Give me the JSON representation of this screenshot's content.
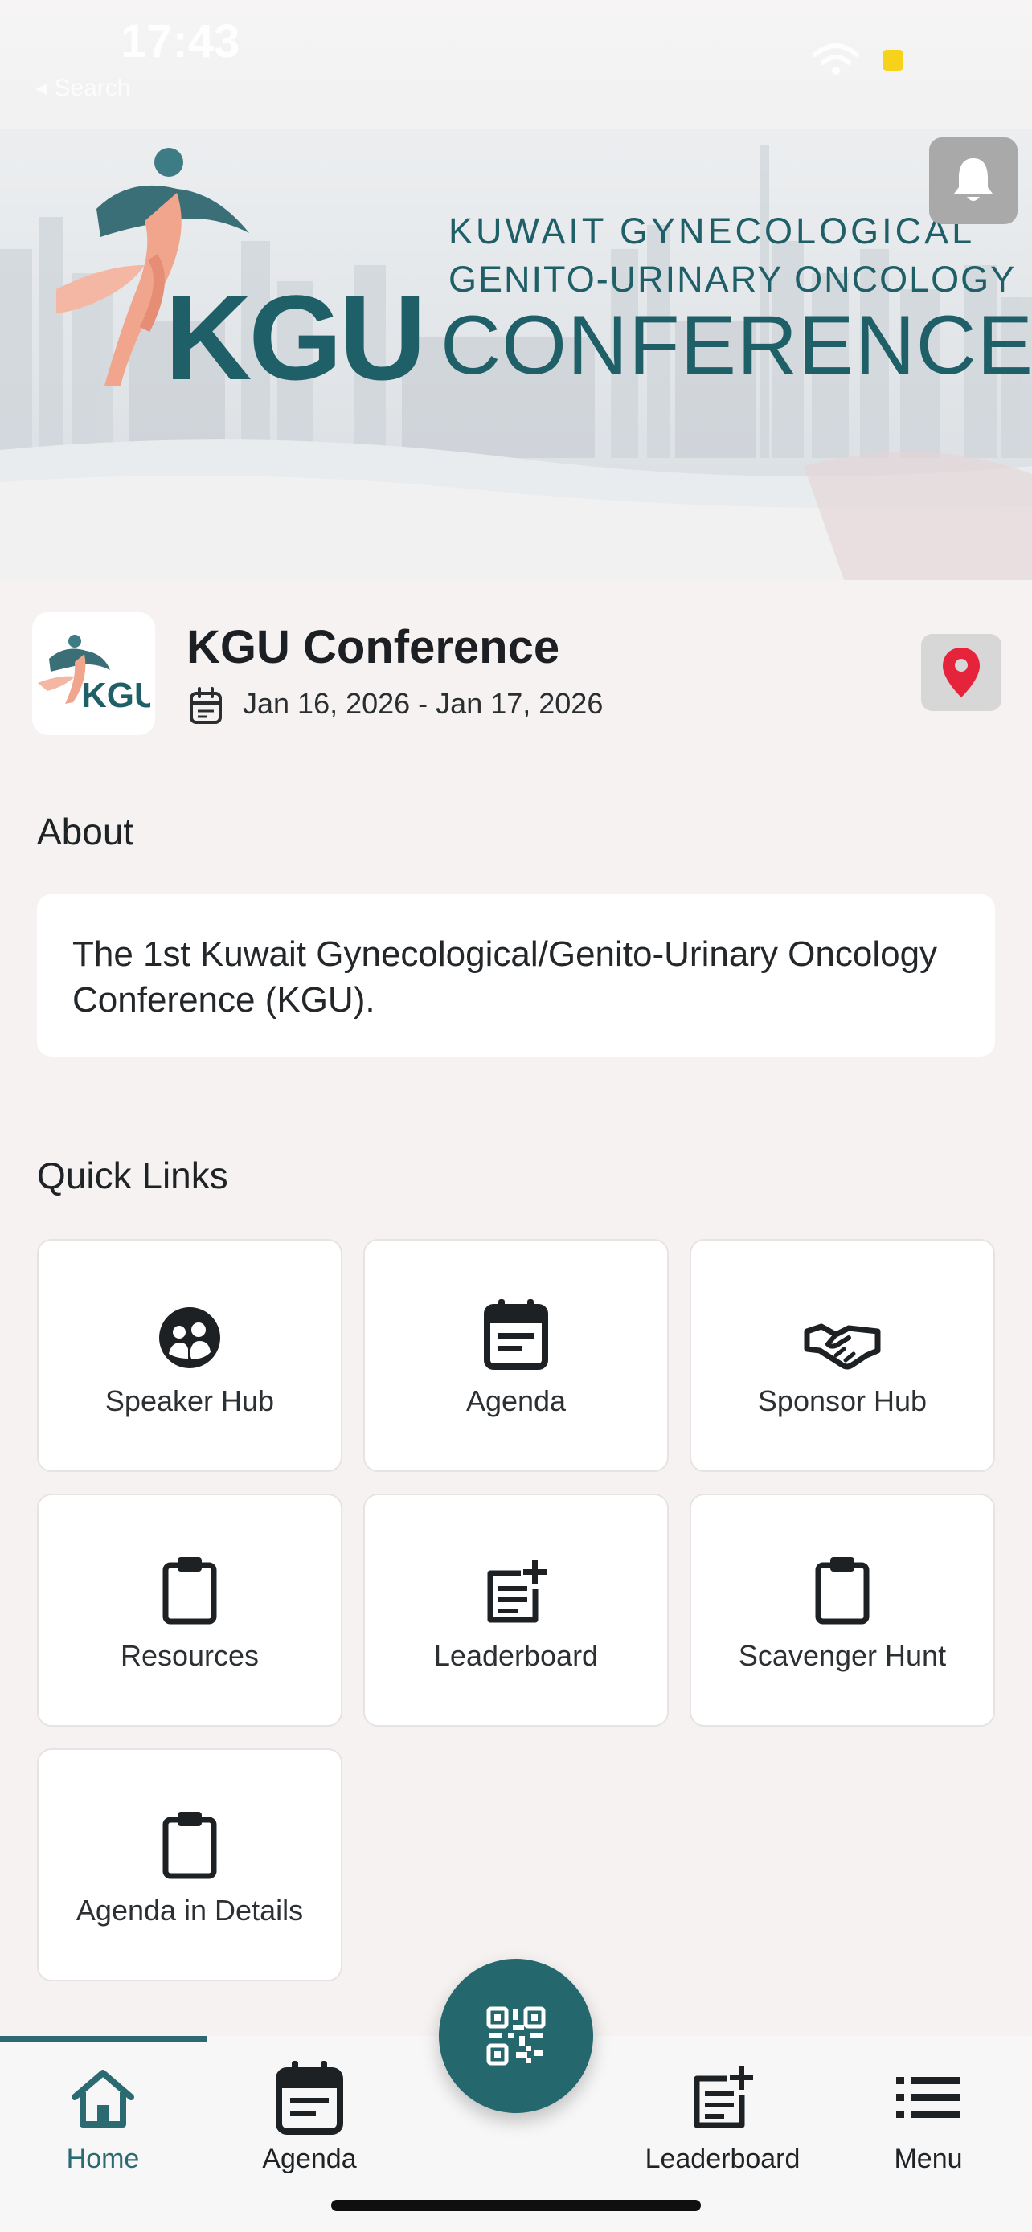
{
  "status_bar": {
    "time": "17:43",
    "back_label": "◂ Search"
  },
  "banner": {
    "logo_text": "KGU",
    "line1": "KUWAIT GYNECOLOGICAL",
    "line2": "GENITO-URINARY ONCOLOGY",
    "line3": "CONFERENCE",
    "notification_icon": "bell-icon"
  },
  "event": {
    "logo_text": "KGU",
    "title": "KGU Conference",
    "dates": "Jan 16, 2026 - Jan 17, 2026",
    "calendar_icon": "calendar-icon",
    "location_icon": "map-pin-icon"
  },
  "about": {
    "heading": "About",
    "text": "The 1st Kuwait Gynecological/Genito-Urinary Oncology Conference (KGU)."
  },
  "quick_links": {
    "heading": "Quick Links",
    "items": [
      {
        "label": "Speaker Hub",
        "icon": "speaker-group-icon"
      },
      {
        "label": "Agenda",
        "icon": "calendar-icon"
      },
      {
        "label": "Sponsor Hub",
        "icon": "handshake-icon"
      },
      {
        "label": "Resources",
        "icon": "clipboard-icon"
      },
      {
        "label": "Leaderboard",
        "icon": "note-add-icon"
      },
      {
        "label": "Scavenger Hunt",
        "icon": "clipboard-icon"
      },
      {
        "label": "Agenda in Details",
        "icon": "clipboard-icon"
      }
    ]
  },
  "bottom_nav": {
    "active": "Home",
    "items": [
      {
        "label": "Home",
        "icon": "home-icon"
      },
      {
        "label": "Agenda",
        "icon": "calendar-icon"
      },
      {
        "label": "Leaderboard",
        "icon": "note-add-icon"
      },
      {
        "label": "Menu",
        "icon": "list-icon"
      }
    ],
    "center_icon": "qr-code-icon"
  },
  "colors": {
    "brand_teal": "#1f5f67",
    "accent_teal": "#2a6a70",
    "ribbon_salmon": "#ef9e86",
    "pin_red": "#e5243b",
    "background": "#f5f2f1"
  }
}
